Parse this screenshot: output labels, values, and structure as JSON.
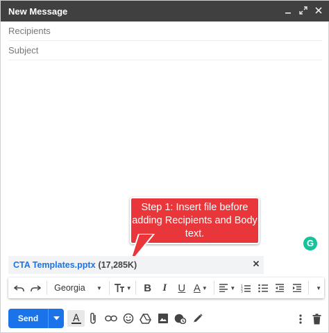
{
  "window": {
    "title": "New Message",
    "controls": [
      "minimize-icon",
      "pop-out-icon",
      "close-icon"
    ]
  },
  "fields": {
    "recipients_placeholder": "Recipients",
    "subject_placeholder": "Subject"
  },
  "callout": {
    "text": "Step 1: Insert file before adding Recipients and Body text.",
    "color": "#e8363a"
  },
  "attachment": {
    "name": "CTA Templates.pptx",
    "size": "(17,285K)",
    "remove_icon": "close-icon"
  },
  "format_toolbar": {
    "font": "Georgia",
    "items": [
      "undo-icon",
      "redo-icon",
      "font-select",
      "font-size-icon",
      "bold-icon",
      "italic-icon",
      "underline-icon",
      "text-color-icon",
      "align-icon",
      "numbered-list-icon",
      "bulleted-list-icon",
      "indent-less-icon",
      "indent-more-icon",
      "more-formatting-icon"
    ]
  },
  "bottom_bar": {
    "send_label": "Send",
    "icons": [
      "formatting-options-icon",
      "attach-file-icon",
      "insert-link-icon",
      "insert-emoji-icon",
      "google-drive-icon",
      "insert-photo-icon",
      "confidential-mode-icon",
      "insert-signature-icon",
      "more-options-icon",
      "discard-draft-icon"
    ]
  },
  "colors": {
    "titlebar": "#404040",
    "send": "#1a73e8",
    "attachment_link": "#1a73e8",
    "grammarly": "#15c39a"
  }
}
